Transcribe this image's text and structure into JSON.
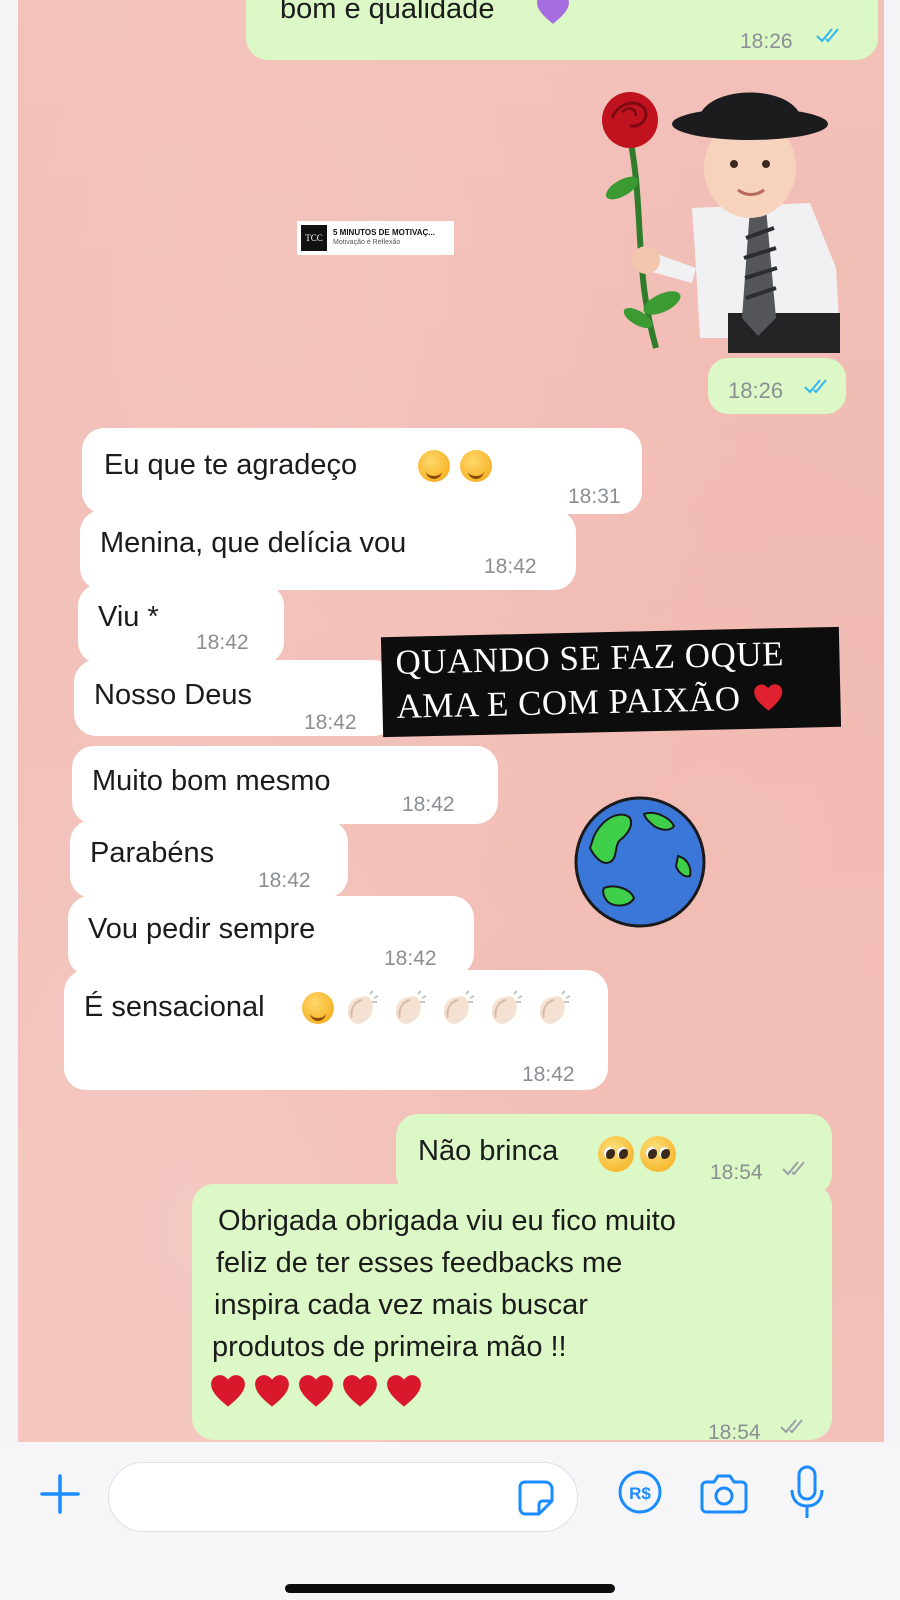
{
  "messages": [
    {
      "id": "m0",
      "direction": "outgoing",
      "text": "bom e qualidade",
      "time": "18:26",
      "status": "read"
    },
    {
      "id": "m1",
      "direction": "outgoing",
      "type": "sticker",
      "time": "18:26",
      "status": "read"
    },
    {
      "id": "m2",
      "direction": "incoming",
      "text": "Eu que te agradeço",
      "time": "18:31"
    },
    {
      "id": "m3",
      "direction": "incoming",
      "text": "Menina, que delícia vou",
      "time": "18:42"
    },
    {
      "id": "m4",
      "direction": "incoming",
      "text": "Viu *",
      "time": "18:42"
    },
    {
      "id": "m5",
      "direction": "incoming",
      "text": "Nosso Deus",
      "time": "18:42"
    },
    {
      "id": "m6",
      "direction": "incoming",
      "text": "Muito bom mesmo",
      "time": "18:42"
    },
    {
      "id": "m7",
      "direction": "incoming",
      "text": "Parabéns",
      "time": "18:42"
    },
    {
      "id": "m8",
      "direction": "incoming",
      "text": "Vou pedir sempre",
      "time": "18:42"
    },
    {
      "id": "m9",
      "direction": "incoming",
      "text": "É sensacional",
      "time": "18:42"
    },
    {
      "id": "m10",
      "direction": "outgoing",
      "text": "Não brinca",
      "time": "18:54",
      "status": "delivered"
    },
    {
      "id": "m11",
      "direction": "outgoing",
      "lines": [
        "Obrigada obrigada viu  eu fico muito",
        "feliz de ter esses feedbacks me",
        "inspira cada vez mais buscar",
        "produtos de primeira mão !!"
      ],
      "time": "18:54",
      "status": "delivered"
    }
  ],
  "overlay_caption": {
    "line1": "QUANDO SE FAZ OQUE",
    "line2": "AMA E COM PAIXÃO"
  },
  "watermark": {
    "logo": "TCC",
    "title": "5 MINUTOS DE MOTIVAÇ...",
    "subtitle": "Motivação e Reflexão"
  },
  "input_bar": {
    "placeholder": "",
    "icons": [
      "plus-icon",
      "sticker-icon",
      "payment-icon",
      "camera-icon",
      "microphone-icon"
    ],
    "payment_label": "R$"
  },
  "colors": {
    "outgoing_bubble": "#dcf8c6",
    "incoming_bubble": "#ffffff",
    "read_ticks": "#34b7f1",
    "delivered_ticks": "#9aa0a6",
    "accent": "#1a8cff",
    "chat_background": "#f2c1ba"
  }
}
